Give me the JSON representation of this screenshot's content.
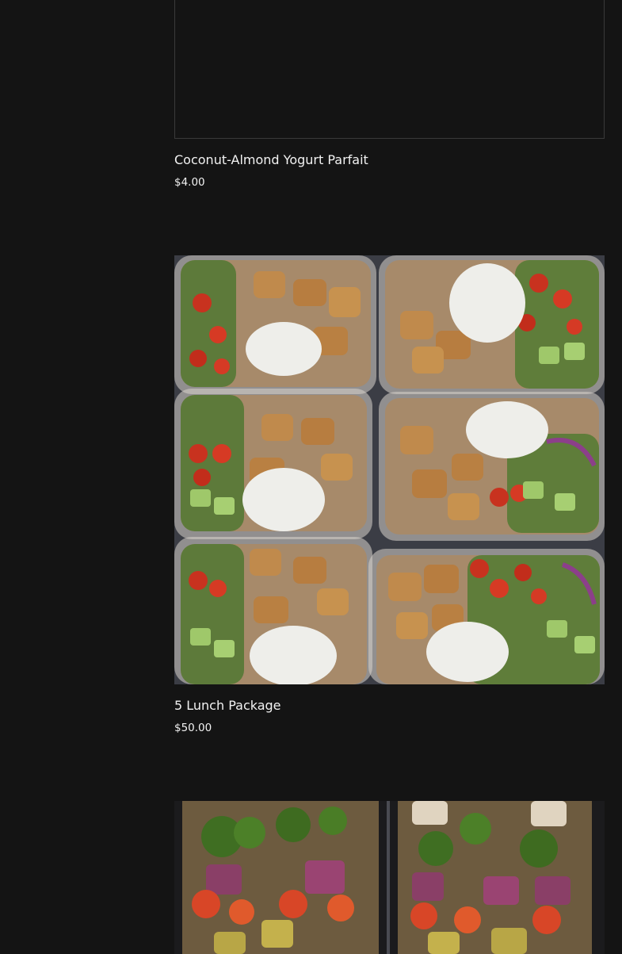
{
  "products": [
    {
      "name": "Coconut-Almond Yogurt Parfait",
      "price": "$4.00",
      "image_alt": ""
    },
    {
      "name": "5 Lunch Package",
      "price": "$50.00",
      "image_alt": ""
    },
    {
      "name": "",
      "price": "",
      "image_alt": ""
    }
  ],
  "colors": {
    "background": "#141414",
    "text": "#f2f2f2",
    "image_border": "#3a3a3a"
  }
}
